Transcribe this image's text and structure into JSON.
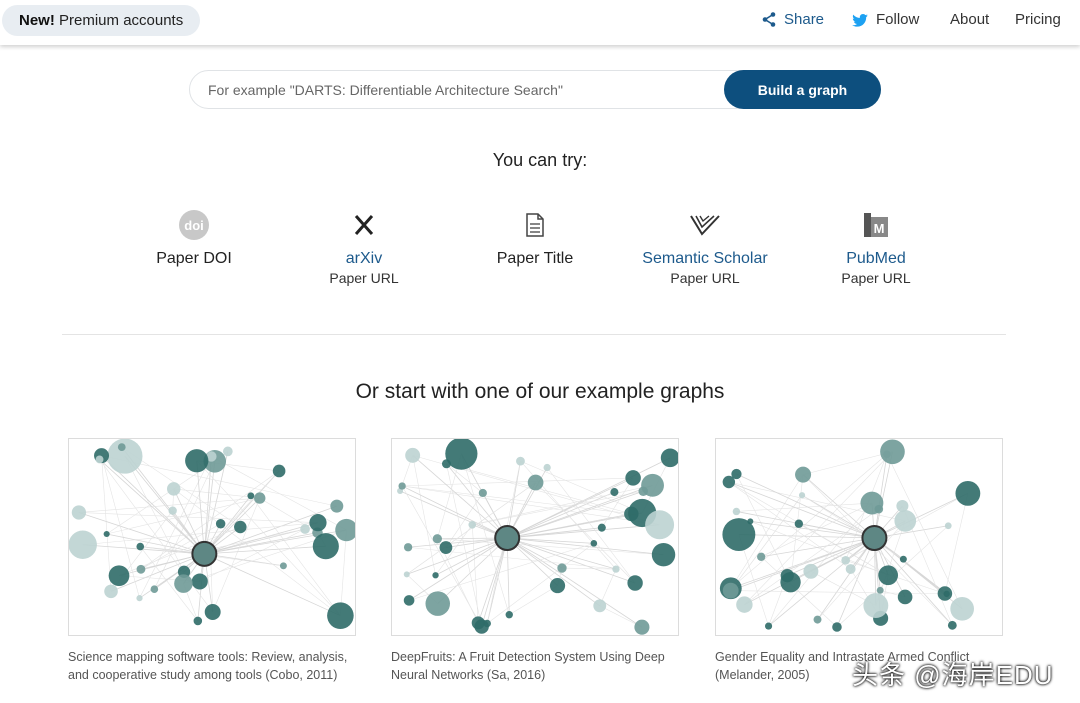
{
  "topbar": {
    "promo_badge": "New!",
    "promo_text": "Premium accounts",
    "share_label": "Share",
    "follow_label": "Follow",
    "about_label": "About",
    "pricing_label": "Pricing"
  },
  "search": {
    "placeholder": "For example \"DARTS: Differentiable Architecture Search\"",
    "value": "",
    "button_label": "Build a graph"
  },
  "try_title": "You can try:",
  "sources": [
    {
      "label": "Paper DOI",
      "sub": "",
      "icon": "doi-icon"
    },
    {
      "label": "arXiv",
      "sub": "Paper URL",
      "icon": "arxiv-icon"
    },
    {
      "label": "Paper Title",
      "sub": "",
      "icon": "document-icon"
    },
    {
      "label": "Semantic Scholar",
      "sub": "Paper URL",
      "icon": "semantic-scholar-icon"
    },
    {
      "label": "PubMed",
      "sub": "Paper URL",
      "icon": "pubmed-icon"
    }
  ],
  "examples_title": "Or start with one of our example graphs",
  "examples": [
    {
      "caption": "Science mapping software tools: Review, analysis, and cooperative study among tools (Cobo, 2011)"
    },
    {
      "caption": "DeepFruits: A Fruit Detection System Using Deep Neural Networks (Sa, 2016)"
    },
    {
      "caption": "Gender Equality and Intrastate Armed Conflict (Melander, 2005)"
    }
  ],
  "watermark": "头条 @海岸EDU",
  "colors": {
    "brand_blue": "#0d4f7e",
    "link_blue": "#1d5a8c",
    "node_dark": "#2f6b68",
    "node_light": "#bcd3d1"
  }
}
